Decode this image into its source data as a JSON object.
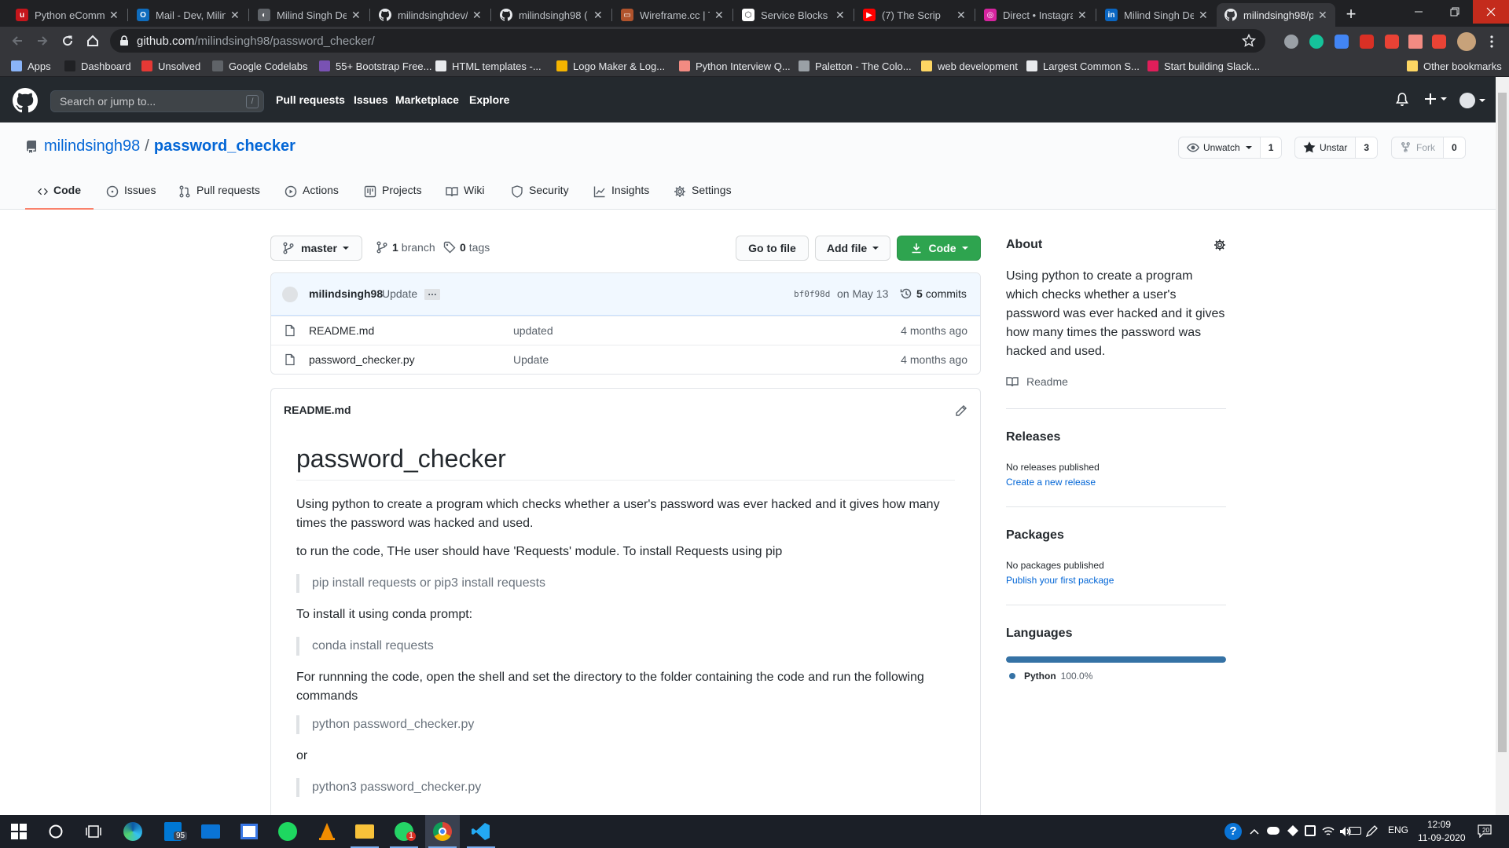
{
  "browser": {
    "tabs": [
      {
        "title": "Python eComme",
        "fav_color": "#c4161c",
        "fav_glyph": "u",
        "active": false
      },
      {
        "title": "Mail - Dev, Milin",
        "fav_color": "#0f6cbd",
        "fav_glyph": "O",
        "active": false
      },
      {
        "title": "Milind Singh Dev",
        "fav_color": "#5f6368",
        "fav_glyph": "◐",
        "active": false
      },
      {
        "title": "milindsinghdev/",
        "fav_color": "#202124",
        "fav_glyph": "github",
        "active": false
      },
      {
        "title": "milindsingh98 (",
        "fav_color": "#202124",
        "fav_glyph": "github",
        "active": false
      },
      {
        "title": "Wireframe.cc | T",
        "fav_color": "#b0532c",
        "fav_glyph": "▭",
        "active": false
      },
      {
        "title": "Service Blocks",
        "fav_color": "#ffffff",
        "fav_glyph": "⬡",
        "active": false
      },
      {
        "title": "(7) The Scrip",
        "fav_color": "#ff0000",
        "fav_glyph": "▶",
        "active": false
      },
      {
        "title": "Direct • Instagra",
        "fav_color": "#d6249f",
        "fav_glyph": "◎",
        "active": false
      },
      {
        "title": "Milind Singh De",
        "fav_color": "#0a66c2",
        "fav_glyph": "in",
        "active": false
      },
      {
        "title": "milindsingh98/p",
        "fav_color": "#202124",
        "fav_glyph": "github",
        "active": true
      }
    ],
    "url_host": "github.com",
    "url_path": "/milindsingh98/password_checker/",
    "bookmarks": [
      {
        "label": "Apps",
        "color": "#8ab4f8"
      },
      {
        "label": "Dashboard",
        "color": "#202124"
      },
      {
        "label": "Unsolved",
        "color": "#e53935"
      },
      {
        "label": "Google Codelabs",
        "color": "#5f6368"
      },
      {
        "label": "55+ Bootstrap Free...",
        "color": "#7952b3"
      },
      {
        "label": "HTML templates -...",
        "color": "#e8eaed"
      },
      {
        "label": "Logo Maker & Log...",
        "color": "#f4b400"
      },
      {
        "label": "Python Interview Q...",
        "color": "#f28b82"
      },
      {
        "label": "Paletton - The Colo...",
        "color": "#9aa0a6"
      },
      {
        "label": "web development",
        "color": "#fdd663"
      },
      {
        "label": "Largest Common S...",
        "color": "#e8eaed"
      },
      {
        "label": "Start building Slack...",
        "color": "#e01e5a"
      },
      {
        "label": "Other bookmarks",
        "color": "#fdd663"
      }
    ]
  },
  "gh_header": {
    "search_placeholder": "Search or jump to...",
    "search_hotkey": "/",
    "nav": [
      "Pull requests",
      "Issues",
      "Marketplace",
      "Explore"
    ]
  },
  "repo": {
    "owner": "milindsingh98",
    "separator": "/",
    "name": "password_checker",
    "watch_label": "Unwatch",
    "watch_count": "1",
    "star_label": "Unstar",
    "star_count": "3",
    "fork_label": "Fork",
    "fork_count": "0",
    "tabs": [
      "Code",
      "Issues",
      "Pull requests",
      "Actions",
      "Projects",
      "Wiki",
      "Security",
      "Insights",
      "Settings"
    ],
    "selected_tab": "Code"
  },
  "code_toolbar": {
    "branch": "master",
    "branches_count": "1",
    "branches_label": "branch",
    "tags_count": "0",
    "tags_label": "tags",
    "goto_file": "Go to file",
    "add_file": "Add file",
    "code_button": "Code"
  },
  "latest_commit": {
    "author": "milindsingh98",
    "message": "Update",
    "ellipsis": "…",
    "sha": "bf0f98d",
    "date": "on May 13",
    "commits_count": "5",
    "commits_label": "commits"
  },
  "files": [
    {
      "name": "README.md",
      "message": "updated",
      "age": "4 months ago"
    },
    {
      "name": "password_checker.py",
      "message": "Update",
      "age": "4 months ago"
    }
  ],
  "readme": {
    "filename": "README.md",
    "title": "password_checker",
    "p1": "Using python to create a program which checks whether a user's password was ever hacked and it gives how many times the password was hacked and used.",
    "p2": "to run the code, THe user should have 'Requests' module. To install Requests using pip",
    "q1": "pip install requests or pip3 install requests",
    "p3": "To install it using conda prompt:",
    "q2": "conda install requests",
    "p4": "For runnning the code, open the shell and set the directory to the folder containing the code and run the following commands",
    "q3": "python password_checker.py",
    "p5": "or",
    "q4": "python3 password_checker.py"
  },
  "about": {
    "heading": "About",
    "description": "Using python to create a program which checks whether a user's password was ever hacked and it gives how many times the password was hacked and used.",
    "readme_link": "Readme",
    "releases_heading": "Releases",
    "releases_text": "No releases published",
    "releases_link": "Create a new release",
    "packages_heading": "Packages",
    "packages_text": "No packages published",
    "packages_link": "Publish your first package",
    "languages_heading": "Languages",
    "language_name": "Python",
    "language_percent": "100.0%",
    "language_fraction": 1.0,
    "language_color": "#3572A5"
  },
  "taskbar": {
    "search_badge": "95",
    "whatsapp_badge": "1",
    "lang": "ENG",
    "time": "12:09",
    "date": "11-09-2020",
    "notifications": "20"
  }
}
